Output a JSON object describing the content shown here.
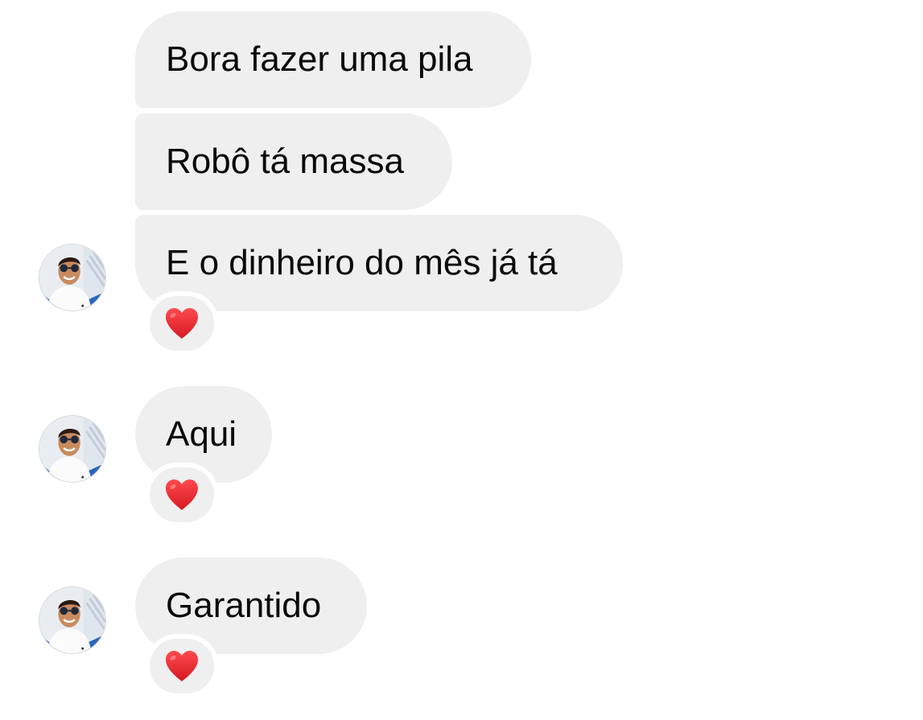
{
  "messages": [
    {
      "text": "Bora fazer uma pila"
    },
    {
      "text": "Robô tá massa"
    },
    {
      "text": "E o dinheiro do mês já tá"
    },
    {
      "text": "Aqui"
    },
    {
      "text": "Garantido"
    }
  ],
  "reactions": {
    "icon": "heart-icon",
    "color": "#e0242b"
  },
  "colors": {
    "bubble_bg": "#efefef",
    "text": "#0a0a0a",
    "background": "#ffffff"
  }
}
